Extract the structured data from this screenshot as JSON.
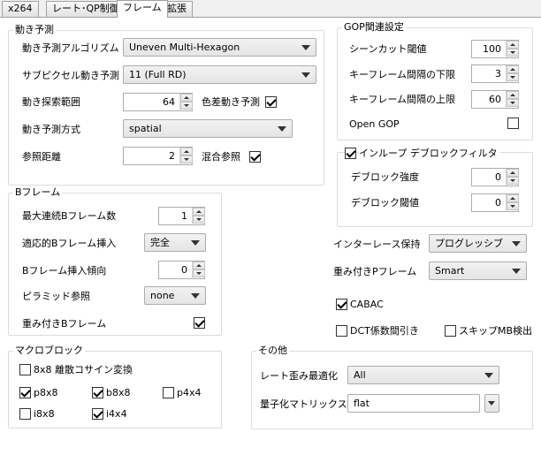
{
  "tabs": [
    "x264",
    "レート･QP制御",
    "フレーム",
    "拡張"
  ],
  "motion": {
    "title": "動き予測",
    "algo_label": "動き予測アルゴリズム",
    "algo_value": "Uneven Multi-Hexagon",
    "subpel_label": "サブピクセル動き予測",
    "subpel_value": "11 (Full RD)",
    "range_label": "動き探索範囲",
    "range_value": "64",
    "chroma_label": "色差動き予測",
    "mode_label": "動き予測方式",
    "mode_value": "spatial",
    "ref_label": "参照距離",
    "ref_value": "2",
    "mixed_label": "混合参照"
  },
  "gop": {
    "title": "GOP関連設定",
    "scenecut_label": "シーンカット閾値",
    "scenecut_value": "100",
    "keyint_min_label": "キーフレーム間隔の下限",
    "keyint_min_value": "3",
    "keyint_max_label": "キーフレーム間隔の上限",
    "keyint_max_value": "60",
    "opengop_label": "Open GOP"
  },
  "deblock": {
    "title": "インループ デブロックフィルタ",
    "strength_label": "デブロック強度",
    "strength_value": "0",
    "threshold_label": "デブロック閾値",
    "threshold_value": "0"
  },
  "bframe": {
    "title": "Bフレーム",
    "max_label": "最大連続Bフレーム数",
    "max_value": "1",
    "adaptive_label": "適応的Bフレーム挿入",
    "adaptive_value": "完全",
    "bias_label": "Bフレーム挿入傾向",
    "bias_value": "0",
    "pyramid_label": "ピラミッド参照",
    "pyramid_value": "none",
    "weighted_label": "重み付きBフレーム"
  },
  "right": {
    "interlace_label": "インターレース保持",
    "interlace_value": "プログレッシブ",
    "weightp_label": "重み付きPフレーム",
    "weightp_value": "Smart",
    "cabac_label": "CABAC",
    "dct_label": "DCT係数間引き",
    "skip_label": "スキップMB検出"
  },
  "macroblock": {
    "title": "マクロブロック",
    "dct8_label": "8x8 離散コサイン変換",
    "p8x8_label": "p8x8",
    "b8x8_label": "b8x8",
    "p4x4_label": "p4x4",
    "i8x8_label": "i8x8",
    "i4x4_label": "i4x4"
  },
  "other": {
    "title": "その他",
    "rdo_label": "レート歪み最適化",
    "rdo_value": "All",
    "cqm_label": "量子化マトリックス",
    "cqm_value": "flat"
  },
  "checkbox_states": {
    "chroma_me": true,
    "mixed_refs": true,
    "open_gop": false,
    "deblock": true,
    "weighted_b": true,
    "cabac": true,
    "dct_decimate": false,
    "skip_detect": false,
    "dct8x8": false,
    "p8x8": true,
    "b8x8": true,
    "p4x4": false,
    "i8x8": false,
    "i4x4": true
  }
}
